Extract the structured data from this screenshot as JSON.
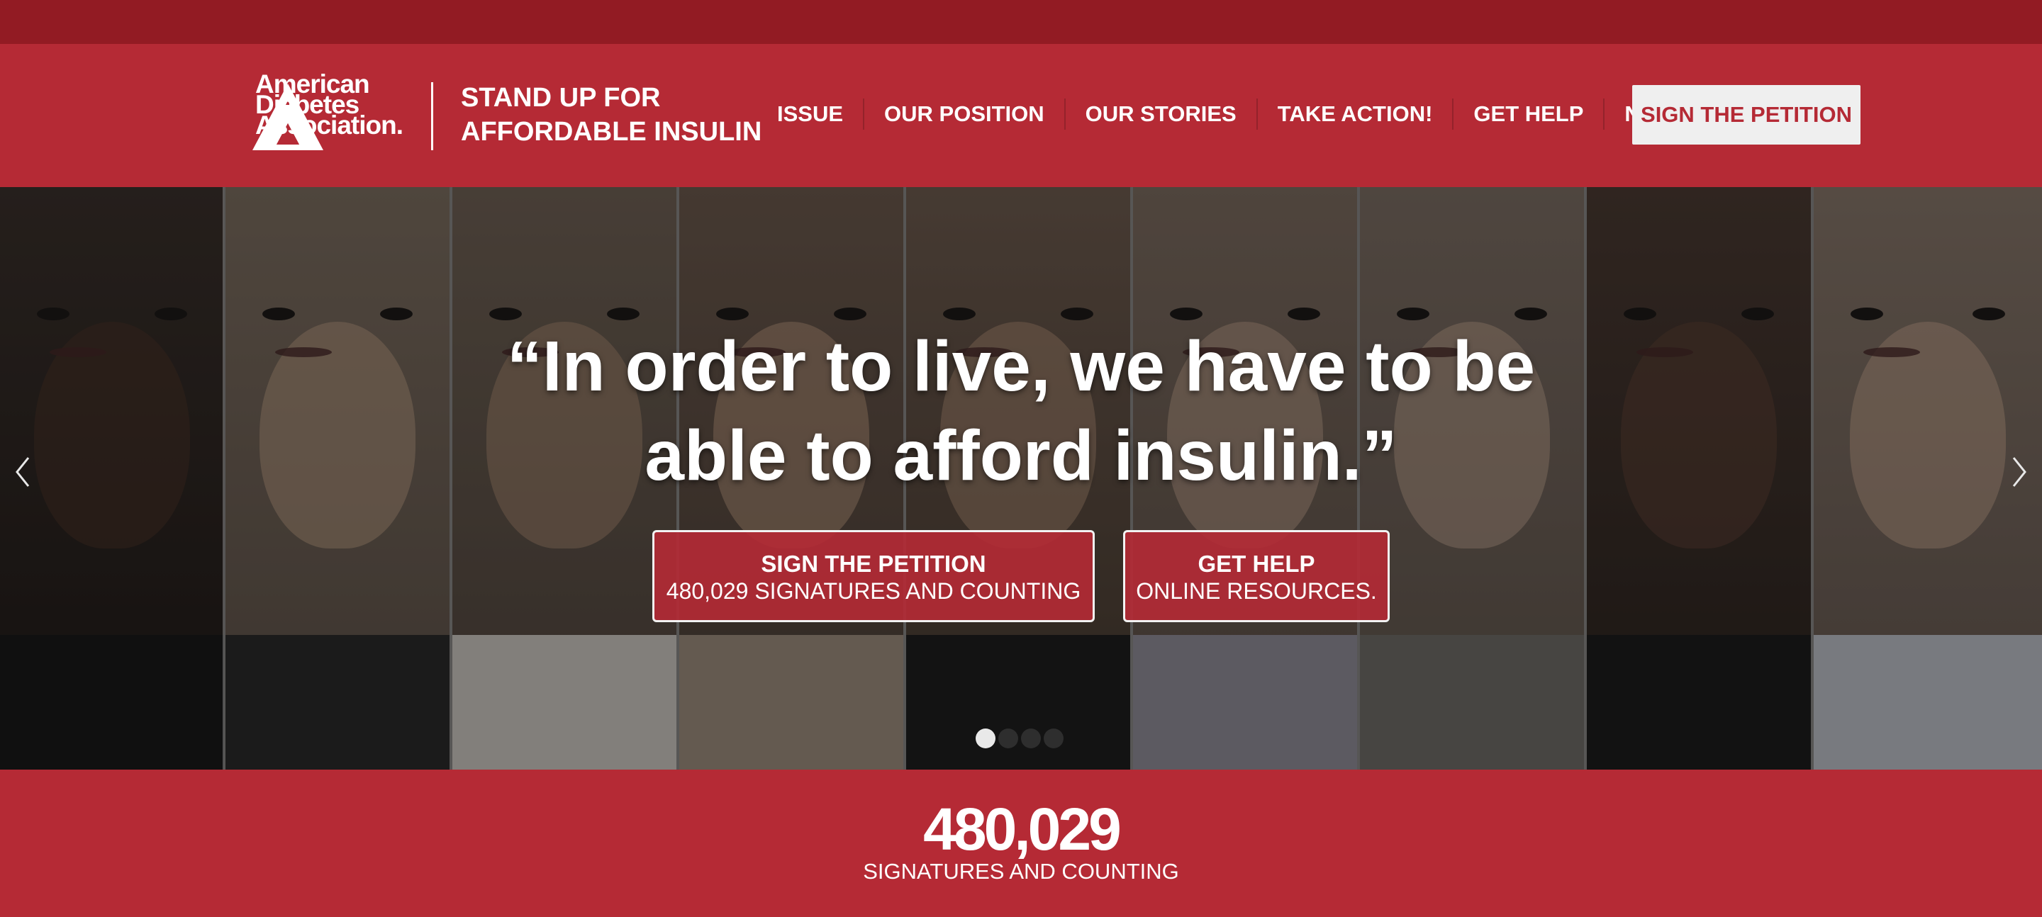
{
  "brand": {
    "org_name_lines": [
      "American",
      "Diabetes",
      "Association."
    ],
    "registered_mark": "®",
    "campaign_lines": [
      "STAND UP FOR",
      "AFFORDABLE INSULIN"
    ],
    "colors": {
      "primary_red": "#b52a35",
      "dark_red": "#921b23",
      "white": "#ffffff",
      "light_gray": "#efefef"
    }
  },
  "nav": {
    "items": [
      {
        "label": "ISSUE"
      },
      {
        "label": "OUR POSITION"
      },
      {
        "label": "OUR STORIES"
      },
      {
        "label": "TAKE ACTION!"
      },
      {
        "label": "GET HELP"
      },
      {
        "label": "NEWS"
      }
    ],
    "cta_label": "SIGN THE PETITION"
  },
  "hero": {
    "quote_lines": [
      "“In order to live, we have to be",
      "able to afford insulin.”"
    ],
    "buttons": {
      "petition": {
        "title": "SIGN THE PETITION",
        "subtitle": "480,029 SIGNATURES AND COUNTING"
      },
      "help": {
        "title": "GET HELP",
        "subtitle": "ONLINE RESOURCES."
      }
    },
    "icons": {
      "prev": "chevron-left-icon",
      "next": "chevron-right-icon"
    },
    "carousel": {
      "slide_count": 4,
      "active_index": 0
    }
  },
  "counter": {
    "count": "480,029",
    "label": "SIGNATURES AND COUNTING"
  }
}
